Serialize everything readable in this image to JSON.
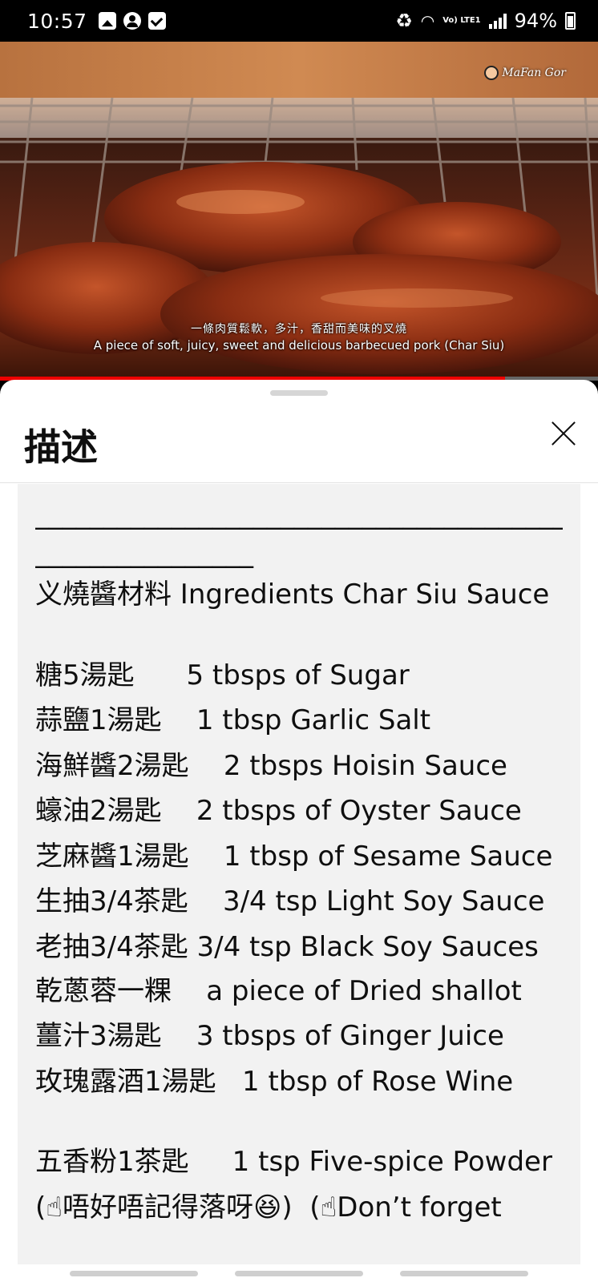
{
  "status_bar": {
    "time": "10:57",
    "lte_label": "Vo) LTE1",
    "battery": "94%"
  },
  "video": {
    "watermark": "MaFan Gor",
    "subtitle_zh": "一條肉質鬆軟，多汁，香甜而美味的叉燒",
    "subtitle_en": "A piece of soft, juicy, sweet and delicious barbecued pork (Char Siu)",
    "progress_fraction": 0.845
  },
  "sheet": {
    "title": "描述",
    "description": {
      "rule_top": "________________________________________",
      "rule_bottom": "________________",
      "heading": "义燒醬材料 Ingredients Char Siu Sauce",
      "ingredients": [
        "糖5湯匙      5 tbsps of Sugar",
        "蒜鹽1湯匙    1 tbsp Garlic Salt",
        "海鮮醬2湯匙    2 tbsps Hoisin Sauce",
        "蠔油2湯匙    2 tbsps of Oyster Sauce",
        "芝麻醬1湯匙    1 tbsp of Sesame Sauce",
        "生抽3/4茶匙    3/4 tsp Light Soy Sauce",
        "老抽3/4茶匙    3/4 tsp Black Soy Sauces",
        "乾蔥蓉一粿    a piece of Dried shallot",
        "薑汁3湯匙    3 tbsps of Ginger Juice",
        "玫瑰露酒1湯匙   1 tbsp of Rose Wine"
      ],
      "extra": [
        "五香粉1茶匙     1 tsp Five-spice Powder",
        "(☝唔好唔記得落呀😆)  (☝Don’t forget"
      ]
    }
  }
}
